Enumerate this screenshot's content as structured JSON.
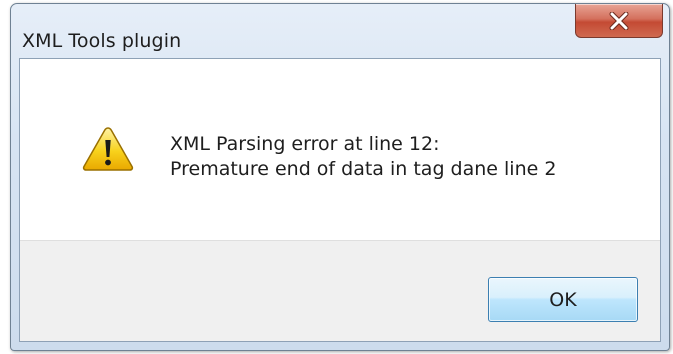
{
  "window": {
    "title": "XML Tools plugin"
  },
  "message": {
    "line1": "XML Parsing error at line 12:",
    "line2": "Premature end of data in tag dane line 2"
  },
  "buttons": {
    "ok_label": "OK"
  },
  "icons": {
    "close": "close-icon",
    "warning": "warning-icon"
  },
  "colors": {
    "close_button": "#c44a34",
    "ok_button_border": "#3c7fb1",
    "warning_yellow": "#f5c400"
  }
}
